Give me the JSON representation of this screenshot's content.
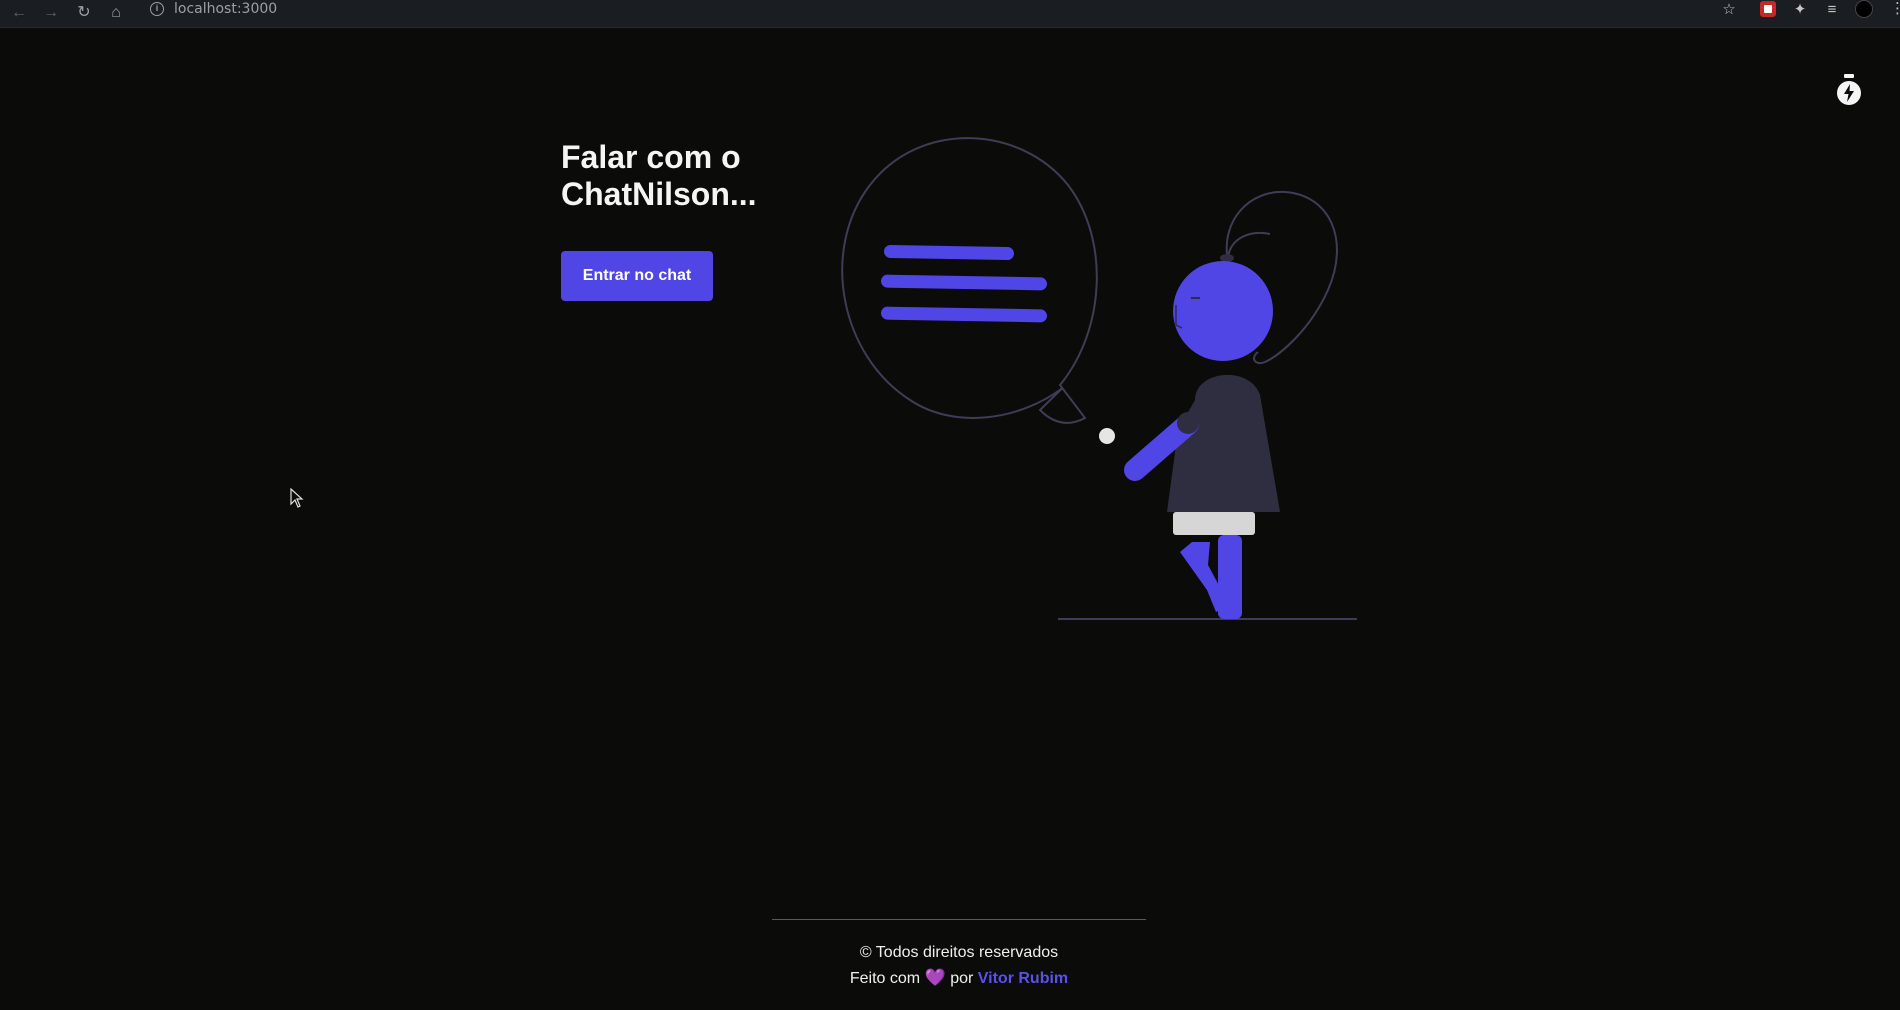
{
  "browser": {
    "url": "localhost:3000"
  },
  "hero": {
    "title": "Falar com o ChatNilson...",
    "button_label": "Entrar no chat"
  },
  "footer": {
    "copyright": "© Todos direitos reservados",
    "made_prefix": "Feito com",
    "heart": "💜",
    "made_by": "por",
    "author": "Vitor Rubim"
  },
  "colors": {
    "background": "#0b0b09",
    "accent": "#4f46e5",
    "dark_shape": "#2f2e41"
  },
  "icons": {
    "theme_toggle": "lightning-bolt-icon"
  }
}
